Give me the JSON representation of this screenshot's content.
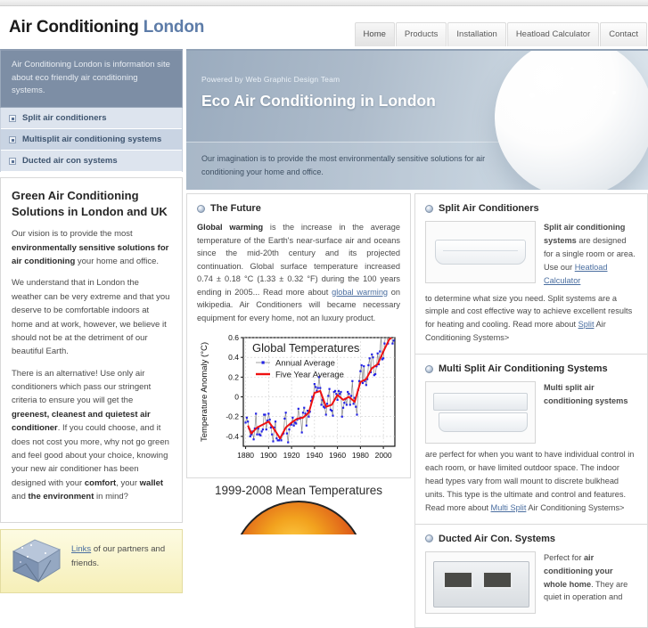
{
  "site": {
    "logo_main": "Air Conditioning",
    "logo_alt": "London"
  },
  "nav": {
    "items": [
      {
        "label": "Home",
        "active": true
      },
      {
        "label": "Products",
        "active": false
      },
      {
        "label": "Installation",
        "active": false
      },
      {
        "label": "Heatload Calculator",
        "active": false
      },
      {
        "label": "Contact",
        "active": false
      }
    ]
  },
  "sidebar": {
    "intro": "Air Conditioning London is information site about eco friendly air conditioning systems.",
    "nav_items": [
      {
        "label": "Split air conditioners"
      },
      {
        "label": "Multisplit air conditioning systems"
      },
      {
        "label": "Ducted air con systems"
      }
    ],
    "panel": {
      "heading": "Green Air Conditioning Solutions in London and UK",
      "p1_a": "Our vision is to provide the most ",
      "p1_b": "environmentally sensitive solutions for air conditioning",
      "p1_c": " your home and office.",
      "p2": "We understand that in London the weather can be very extreme and that you deserve to be comfortable indoors at home and at work, however, we believe it should not be at the detriment of our beautiful Earth.",
      "p3_a": "There is an alternative! Use only air conditioners which pass our stringent criteria to ensure you will get the ",
      "p3_b": "greenest, cleanest and quietest air conditioner",
      "p3_c": ". If you could choose, and it does not cost you more, why not go green and feel good about your choice, knowing your new air conditioner has been designed with your ",
      "p3_d": "comfort",
      "p3_e": ", your ",
      "p3_f": "wallet",
      "p3_g": " and ",
      "p3_h": "the environment",
      "p3_i": " in mind?"
    },
    "links_box": {
      "link_label": "Links",
      "text": " of our partners and friends.",
      "icon": "cube-icon"
    }
  },
  "hero": {
    "powered_by": "Powered by Web Graphic Design Team",
    "title": "Eco Air Conditioning in London",
    "subtitle": "Our imagination is to provide the most environmentally sensitive solutions for air conditioning your home and office.",
    "image": "white-sphere-icon"
  },
  "center": {
    "future": {
      "heading": "The Future",
      "p_a": "Global warming",
      "p_b": " is the increase in the average temperature of the Earth's near-surface air and oceans since the mid-20th century and its projected continuation. Global surface temperature increased 0.74 ± 0.18 °C (1.33 ± 0.32 °F) during the 100 years ending in 2005... Read more about ",
      "link_label": "global warming",
      "p_c": " on wikipedia. Air Conditioners will became necessary equipment for every home, not an luxury product."
    },
    "globe_caption": "1999-2008 Mean Temperatures"
  },
  "chart_data": {
    "type": "line",
    "title": "Global Temperatures",
    "xlabel": "",
    "ylabel": "Temperature Anomaly (°C)",
    "xlim": [
      1878,
      2010
    ],
    "ylim": [
      -0.5,
      0.6
    ],
    "xticks": [
      1880,
      1900,
      1920,
      1940,
      1960,
      1980,
      2000
    ],
    "yticks": [
      -0.4,
      -0.2,
      0,
      0.2,
      0.4,
      0.6
    ],
    "grid": true,
    "legend_position": "top-left",
    "series": [
      {
        "name": "Annual Average",
        "color": "#2323e6",
        "marker": "square",
        "x": [
          1880,
          1881,
          1882,
          1883,
          1884,
          1885,
          1886,
          1887,
          1888,
          1889,
          1890,
          1891,
          1892,
          1893,
          1894,
          1895,
          1896,
          1897,
          1898,
          1899,
          1900,
          1901,
          1902,
          1903,
          1904,
          1905,
          1906,
          1907,
          1908,
          1909,
          1910,
          1911,
          1912,
          1913,
          1914,
          1915,
          1916,
          1917,
          1918,
          1919,
          1920,
          1921,
          1922,
          1923,
          1924,
          1925,
          1926,
          1927,
          1928,
          1929,
          1930,
          1931,
          1932,
          1933,
          1934,
          1935,
          1936,
          1937,
          1938,
          1939,
          1940,
          1941,
          1942,
          1943,
          1944,
          1945,
          1946,
          1947,
          1948,
          1949,
          1950,
          1951,
          1952,
          1953,
          1954,
          1955,
          1956,
          1957,
          1958,
          1959,
          1960,
          1961,
          1962,
          1963,
          1964,
          1965,
          1966,
          1967,
          1968,
          1969,
          1970,
          1971,
          1972,
          1973,
          1974,
          1975,
          1976,
          1977,
          1978,
          1979,
          1980,
          1981,
          1982,
          1983,
          1984,
          1985,
          1986,
          1987,
          1988,
          1989,
          1990,
          1991,
          1992,
          1993,
          1994,
          1995,
          1996,
          1997,
          1998,
          1999,
          2000,
          2001,
          2002,
          2003,
          2004,
          2005,
          2006,
          2007,
          2008,
          2009
        ],
        "y": [
          -0.26,
          -0.21,
          -0.25,
          -0.32,
          -0.4,
          -0.38,
          -0.35,
          -0.43,
          -0.32,
          -0.17,
          -0.38,
          -0.32,
          -0.38,
          -0.39,
          -0.35,
          -0.33,
          -0.18,
          -0.18,
          -0.33,
          -0.24,
          -0.17,
          -0.23,
          -0.31,
          -0.38,
          -0.45,
          -0.31,
          -0.25,
          -0.42,
          -0.44,
          -0.44,
          -0.42,
          -0.44,
          -0.38,
          -0.37,
          -0.22,
          -0.16,
          -0.37,
          -0.46,
          -0.33,
          -0.28,
          -0.28,
          -0.21,
          -0.29,
          -0.26,
          -0.27,
          -0.23,
          -0.12,
          -0.22,
          -0.21,
          -0.36,
          -0.16,
          -0.11,
          -0.17,
          -0.29,
          -0.14,
          -0.2,
          -0.15,
          -0.04,
          0.0,
          0.0,
          0.13,
          0.1,
          0.06,
          0.09,
          0.2,
          0.09,
          -0.08,
          -0.03,
          -0.1,
          -0.11,
          -0.18,
          -0.07,
          0.01,
          0.08,
          -0.13,
          -0.14,
          -0.19,
          0.05,
          0.06,
          0.03,
          -0.03,
          0.06,
          0.03,
          0.05,
          -0.2,
          -0.11,
          -0.06,
          -0.02,
          -0.08,
          0.05,
          0.03,
          -0.08,
          0.01,
          0.16,
          -0.07,
          -0.01,
          -0.1,
          -0.18,
          0.07,
          0.16,
          0.26,
          0.32,
          0.14,
          0.31,
          0.16,
          0.12,
          0.18,
          0.32,
          0.39,
          0.25,
          0.43,
          0.4,
          0.22,
          0.23,
          0.31,
          0.44,
          0.33,
          0.46,
          0.61,
          0.38,
          0.39,
          0.54,
          0.63,
          0.62,
          0.54,
          0.68,
          0.64,
          0.66,
          0.54,
          0.57
        ]
      },
      {
        "name": "Five Year Average",
        "color": "#ee1111",
        "marker": "none",
        "x": [
          1882,
          1885,
          1890,
          1895,
          1900,
          1905,
          1910,
          1915,
          1920,
          1925,
          1930,
          1935,
          1940,
          1945,
          1950,
          1955,
          1960,
          1965,
          1970,
          1975,
          1980,
          1985,
          1990,
          1995,
          2000,
          2005,
          2007
        ],
        "y": [
          -0.29,
          -0.37,
          -0.31,
          -0.28,
          -0.25,
          -0.33,
          -0.42,
          -0.31,
          -0.26,
          -0.22,
          -0.21,
          -0.16,
          0.04,
          0.06,
          -0.1,
          -0.08,
          0.02,
          -0.03,
          0.0,
          -0.05,
          0.15,
          0.18,
          0.29,
          0.33,
          0.46,
          0.58,
          0.6
        ]
      }
    ]
  },
  "right": {
    "blocks": [
      {
        "heading": "Split Air Conditioners",
        "image": "split-unit-image",
        "lead_bold": "Split air conditioning systems",
        "lead_rest": " are designed for a single room or area. Use our ",
        "link_label": "Heatload Calculator",
        "lead_tail": " to determine what size you need. Split systems are a simple and cost effective way to achieve excellent results for heating and cooling. Read more about ",
        "link2_label": "Split",
        "tail2": " Air Conditioning Systems>"
      },
      {
        "heading": "Multi Split Air Conditioning Systems",
        "image": "multi-split-unit-image",
        "lead_bold": "Multi split air conditioning systems",
        "lead_rest": " are perfect for when you want to have individual control in each room, or have limited outdoor space. The indoor head types vary from wall mount to discrete bulkhead units. This type is the ultimate and control and features. Read more about ",
        "link_label": "Multi Split",
        "tail2": " Air Conditioning Systems>"
      },
      {
        "heading": "Ducted Air Con. Systems",
        "image": "ducted-unit-image",
        "lead_rest": "Perfect for ",
        "lead_bold": "air conditioning your whole home",
        "tail2": ". They are quiet in operation and"
      }
    ]
  },
  "colors": {
    "brand_blue": "#5d7ca8",
    "sidebar_intro_bg": "#7d8ea5",
    "nav_odd": "#dde4ee",
    "nav_even": "#c9d4e3",
    "link": "#4a6ea0",
    "chart_annual": "#2323e6",
    "chart_fiveyear": "#ee1111"
  }
}
